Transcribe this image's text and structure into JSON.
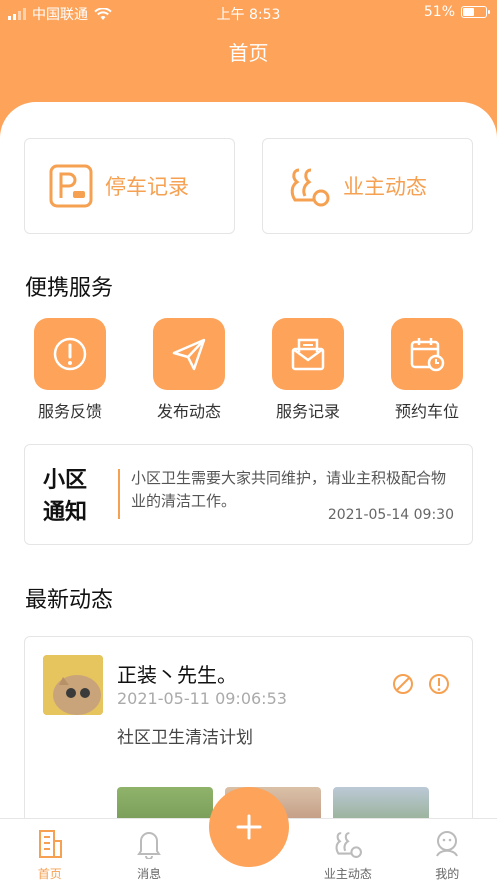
{
  "status_bar": {
    "carrier": "中国联通",
    "time": "上午 8:53",
    "battery": "51%"
  },
  "header": {
    "title": "首页"
  },
  "quick_cards": [
    {
      "label": "停车记录",
      "icon": "parking-icon"
    },
    {
      "label": "业主动态",
      "icon": "owner-news-icon"
    }
  ],
  "services": {
    "title": "便携服务",
    "items": [
      {
        "label": "服务反馈",
        "icon": "exclamation-circle-icon"
      },
      {
        "label": "发布动态",
        "icon": "paper-plane-icon"
      },
      {
        "label": "服务记录",
        "icon": "mail-envelope-icon"
      },
      {
        "label": "预约车位",
        "icon": "calendar-clock-icon"
      }
    ]
  },
  "notice": {
    "tag_line1": "小区",
    "tag_line2": "通知",
    "text": "小区卫生需要大家共同维护，请业主积极配合物业的清洁工作。",
    "time": "2021-05-14 09:30"
  },
  "latest": {
    "title": "最新动态",
    "post": {
      "author": "正装丶先生。",
      "time": "2021-05-11 09:06:53",
      "body": "社区卫生清洁计划"
    }
  },
  "tabbar": {
    "items": [
      {
        "label": "首页",
        "icon": "building-icon",
        "active": true
      },
      {
        "label": "消息",
        "icon": "bell-icon"
      },
      {
        "label": "业主动态",
        "icon": "owner-news-icon"
      },
      {
        "label": "我的",
        "icon": "user-icon"
      }
    ],
    "fab_icon": "plus-icon"
  },
  "colors": {
    "accent": "#FDA35A",
    "accent_text": "#F6A052"
  }
}
